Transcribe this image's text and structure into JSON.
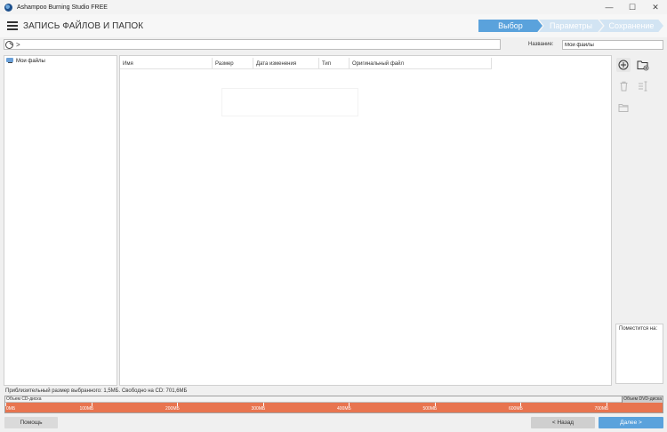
{
  "window": {
    "title": "Ashampoo Burning Studio FREE",
    "controls": {
      "minimize": "—",
      "maximize": "☐",
      "close": "✕"
    }
  },
  "header": {
    "title": "ЗАПИСЬ ФАЙЛОВ И ПАПОК",
    "steps": [
      {
        "label": "Выбор",
        "active": true
      },
      {
        "label": "Параметры",
        "active": false
      },
      {
        "label": "Сохранение",
        "active": false
      }
    ]
  },
  "path_bar": {
    "chevron": ">"
  },
  "name_field": {
    "label": "Название:",
    "value": "Мои файлы"
  },
  "tree": {
    "items": [
      {
        "label": "Мои файлы",
        "icon": "disc-folder-icon"
      }
    ]
  },
  "file_list": {
    "columns": [
      "Имя",
      "Размер",
      "Дата изменения",
      "Тип",
      "Оригинальный файл"
    ]
  },
  "right_panel": {
    "fit_label": "Поместится на:"
  },
  "footer": {
    "size_info": "Приблизительный размер выбранного: 1,5МБ. Свободно на CD: 701,6МБ",
    "capacity": {
      "cd_label": "Объем CD-диска",
      "dvd_label": "Объем DVD-диска",
      "ticks": [
        "0МБ",
        "100МБ",
        "200МБ",
        "300МБ",
        "400МБ",
        "500МБ",
        "600МБ",
        "700МБ"
      ],
      "fill_color": "#e8744f"
    }
  },
  "buttons": {
    "help": "Помощь",
    "back": "< Назад",
    "next": "Далее >"
  },
  "colors": {
    "accent": "#5aa2dc",
    "step_inactive": "#d2e4f3"
  }
}
